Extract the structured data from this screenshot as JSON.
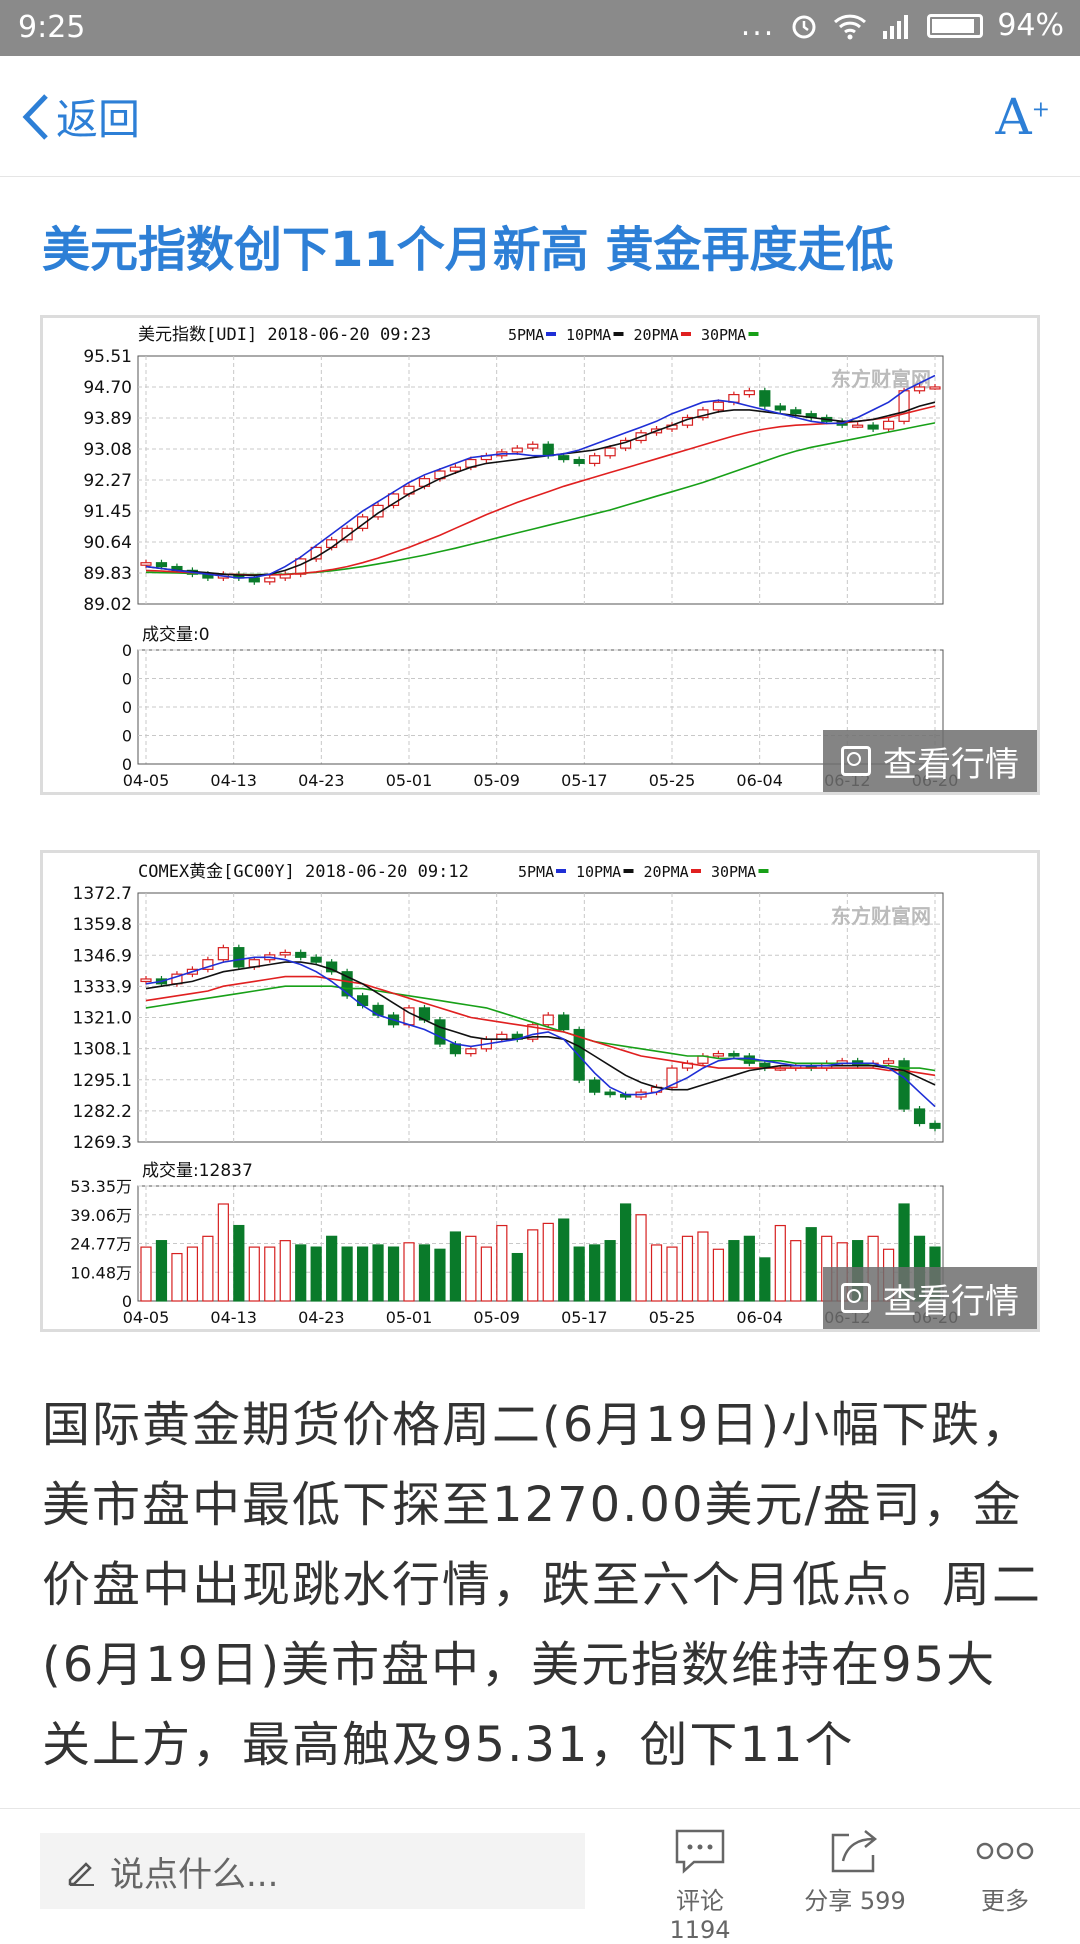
{
  "status": {
    "time": "9:25",
    "dots": "...",
    "battery": "94%"
  },
  "nav": {
    "back_label": "返回",
    "font_icon": "A"
  },
  "article": {
    "title": "美元指数创下11个月新高 黄金再度走低",
    "body": "国际黄金期货价格周二(6月19日)小幅下跌，美市盘中最低下探至1270.00美元/盎司，金价盘中出现跳水行情，跌至六个月低点。周二(6月19日)美市盘中，美元指数维持在95大关上方，最高触及95.31，创下11个"
  },
  "chart_data": [
    {
      "type": "line",
      "header": "美元指数[UDI] 2018-06-20 09:23",
      "legend": [
        "5PMA",
        "10PMA",
        "20PMA",
        "30PMA"
      ],
      "legend_colors": [
        "#1f2fd6",
        "#111111",
        "#e02020",
        "#18a018"
      ],
      "y_ticks": [
        "95.51",
        "94.70",
        "93.89",
        "93.08",
        "92.27",
        "91.45",
        "90.64",
        "89.83",
        "89.02"
      ],
      "ylim": [
        89.02,
        95.51
      ],
      "x_ticks": [
        "04-05",
        "04-13",
        "04-23",
        "05-01",
        "05-09",
        "05-17",
        "05-25",
        "06-04",
        "06-12",
        "06-20"
      ],
      "volume_label": "成交量:0",
      "volume_ticks": [
        "0",
        "0",
        "0",
        "0",
        "0"
      ],
      "watermark": "东方财富网",
      "view_label": "查看行情",
      "close": [
        90.1,
        90.0,
        89.9,
        89.8,
        89.7,
        89.8,
        89.7,
        89.6,
        89.7,
        89.8,
        90.2,
        90.5,
        90.7,
        91.0,
        91.3,
        91.6,
        91.9,
        92.1,
        92.3,
        92.5,
        92.6,
        92.8,
        92.9,
        93.0,
        93.1,
        93.2,
        92.9,
        92.8,
        92.7,
        92.9,
        93.1,
        93.3,
        93.5,
        93.6,
        93.7,
        93.9,
        94.1,
        94.3,
        94.5,
        94.6,
        94.2,
        94.1,
        94.0,
        93.9,
        93.8,
        93.7,
        93.7,
        93.6,
        93.8,
        94.6,
        94.7,
        94.7
      ],
      "ma5": [
        90.0,
        89.95,
        89.9,
        89.85,
        89.8,
        89.75,
        89.7,
        89.72,
        89.8,
        90.0,
        90.25,
        90.55,
        90.85,
        91.15,
        91.45,
        91.7,
        91.95,
        92.2,
        92.4,
        92.55,
        92.7,
        92.85,
        92.9,
        92.95,
        92.95,
        92.9,
        92.9,
        92.95,
        93.05,
        93.2,
        93.35,
        93.5,
        93.65,
        93.8,
        94.0,
        94.15,
        94.3,
        94.35,
        94.3,
        94.2,
        94.1,
        94.0,
        93.9,
        93.8,
        93.75,
        93.75,
        93.9,
        94.1,
        94.3,
        94.6,
        94.8,
        95.0
      ],
      "ma10": [
        90.0,
        89.95,
        89.9,
        89.87,
        89.84,
        89.8,
        89.78,
        89.77,
        89.8,
        89.9,
        90.05,
        90.25,
        90.5,
        90.8,
        91.1,
        91.4,
        91.65,
        91.9,
        92.1,
        92.3,
        92.45,
        92.6,
        92.7,
        92.75,
        92.8,
        92.85,
        92.9,
        92.95,
        93.0,
        93.05,
        93.15,
        93.25,
        93.4,
        93.55,
        93.7,
        93.85,
        93.95,
        94.05,
        94.1,
        94.1,
        94.05,
        94.0,
        93.95,
        93.9,
        93.85,
        93.8,
        93.8,
        93.85,
        93.95,
        94.05,
        94.2,
        94.3
      ],
      "ma20": [
        89.9,
        89.88,
        89.86,
        89.84,
        89.82,
        89.8,
        89.79,
        89.78,
        89.78,
        89.79,
        89.82,
        89.86,
        89.92,
        90.0,
        90.1,
        90.22,
        90.36,
        90.5,
        90.66,
        90.82,
        91.0,
        91.18,
        91.36,
        91.52,
        91.68,
        91.82,
        91.96,
        92.1,
        92.22,
        92.34,
        92.46,
        92.58,
        92.7,
        92.82,
        92.94,
        93.06,
        93.18,
        93.3,
        93.42,
        93.52,
        93.6,
        93.66,
        93.7,
        93.72,
        93.74,
        93.76,
        93.8,
        93.85,
        93.9,
        94.0,
        94.1,
        94.2
      ],
      "ma30": [
        89.85,
        89.84,
        89.83,
        89.82,
        89.81,
        89.8,
        89.79,
        89.79,
        89.79,
        89.8,
        89.82,
        89.85,
        89.89,
        89.94,
        90.0,
        90.07,
        90.14,
        90.22,
        90.3,
        90.39,
        90.48,
        90.58,
        90.68,
        90.78,
        90.88,
        90.98,
        91.08,
        91.18,
        91.28,
        91.38,
        91.48,
        91.6,
        91.72,
        91.84,
        91.96,
        92.08,
        92.2,
        92.34,
        92.48,
        92.62,
        92.76,
        92.9,
        93.02,
        93.12,
        93.2,
        93.28,
        93.36,
        93.44,
        93.52,
        93.6,
        93.68,
        93.76
      ]
    },
    {
      "type": "line",
      "header": "COMEX黄金[GC00Y] 2018-06-20 09:12",
      "legend": [
        "5PMA",
        "10PMA",
        "20PMA",
        "30PMA"
      ],
      "legend_colors": [
        "#1f2fd6",
        "#111111",
        "#e02020",
        "#18a018"
      ],
      "y_ticks": [
        "1372.7",
        "1359.8",
        "1346.9",
        "1333.9",
        "1321.0",
        "1308.1",
        "1295.1",
        "1282.2",
        "1269.3"
      ],
      "ylim": [
        1269.3,
        1372.7
      ],
      "x_ticks": [
        "04-05",
        "04-13",
        "04-23",
        "05-01",
        "05-09",
        "05-17",
        "05-25",
        "06-04",
        "06-12",
        "06-20"
      ],
      "volume_label": "成交量:12837",
      "volume_ticks": [
        "53.35万",
        "39.06万",
        "24.77万",
        "10.48万",
        "0"
      ],
      "volume_max": 53.35,
      "watermark": "东方财富网",
      "view_label": "查看行情",
      "close": [
        1337,
        1335,
        1339,
        1341,
        1345,
        1350,
        1342,
        1345,
        1347,
        1348,
        1346,
        1344,
        1340,
        1330,
        1326,
        1322,
        1318,
        1325,
        1320,
        1310,
        1306,
        1308,
        1312,
        1314,
        1312,
        1318,
        1322,
        1316,
        1295,
        1290,
        1289,
        1288,
        1290,
        1292,
        1300,
        1302,
        1305,
        1306,
        1305,
        1302,
        1300,
        1300,
        1301,
        1300,
        1302,
        1303,
        1301,
        1302,
        1303,
        1283,
        1277,
        1275
      ],
      "ma5": [
        1335,
        1336,
        1338,
        1340,
        1342,
        1344,
        1345,
        1346,
        1346,
        1345,
        1343,
        1340,
        1336,
        1331,
        1326,
        1322,
        1320,
        1318,
        1316,
        1313,
        1310,
        1309,
        1310,
        1311,
        1312,
        1314,
        1315,
        1312,
        1305,
        1298,
        1292,
        1289,
        1289,
        1290,
        1293,
        1296,
        1300,
        1303,
        1304,
        1304,
        1303,
        1302,
        1301,
        1301,
        1301,
        1302,
        1302,
        1302,
        1300,
        1296,
        1290,
        1284
      ],
      "ma10": [
        1333,
        1334,
        1335,
        1336,
        1338,
        1340,
        1341,
        1342,
        1343,
        1344,
        1344,
        1343,
        1341,
        1338,
        1335,
        1331,
        1327,
        1323,
        1320,
        1317,
        1315,
        1313,
        1312,
        1312,
        1312,
        1313,
        1313,
        1312,
        1309,
        1305,
        1301,
        1297,
        1294,
        1292,
        1291,
        1291,
        1293,
        1295,
        1297,
        1299,
        1300,
        1301,
        1301,
        1301,
        1301,
        1301,
        1301,
        1301,
        1300,
        1299,
        1296,
        1293
      ],
      "ma20": [
        1328,
        1329,
        1330,
        1331,
        1332,
        1334,
        1335,
        1336,
        1337,
        1338,
        1338,
        1338,
        1337,
        1336,
        1335,
        1333,
        1331,
        1329,
        1327,
        1325,
        1323,
        1321,
        1320,
        1319,
        1318,
        1317,
        1316,
        1315,
        1313,
        1311,
        1309,
        1307,
        1305,
        1304,
        1303,
        1302,
        1301,
        1300,
        1300,
        1300,
        1300,
        1300,
        1300,
        1300,
        1300,
        1300,
        1300,
        1300,
        1299,
        1299,
        1298,
        1297
      ],
      "ma30": [
        1325,
        1326,
        1327,
        1328,
        1329,
        1330,
        1331,
        1332,
        1333,
        1334,
        1334,
        1334,
        1334,
        1333,
        1333,
        1332,
        1331,
        1330,
        1329,
        1328,
        1327,
        1326,
        1325,
        1323,
        1321,
        1319,
        1317,
        1315,
        1313,
        1311,
        1310,
        1309,
        1308,
        1307,
        1306,
        1305,
        1305,
        1304,
        1304,
        1303,
        1303,
        1303,
        1302,
        1302,
        1302,
        1302,
        1302,
        1301,
        1301,
        1300,
        1300,
        1299
      ],
      "volume": [
        25,
        28,
        22,
        25,
        30,
        45,
        35,
        25,
        25,
        28,
        26,
        25,
        30,
        25,
        25,
        26,
        25,
        27,
        26,
        24,
        32,
        30,
        25,
        35,
        22,
        33,
        36,
        38,
        25,
        26,
        28,
        45,
        40,
        26,
        25,
        30,
        32,
        24,
        28,
        30,
        20,
        35,
        28,
        34,
        30,
        27,
        28,
        30,
        24,
        45,
        30,
        25
      ]
    }
  ],
  "bottom": {
    "input_placeholder": "说点什么...",
    "comment_label": "评论 1194",
    "share_label": "分享 599",
    "more_label": "更多"
  }
}
